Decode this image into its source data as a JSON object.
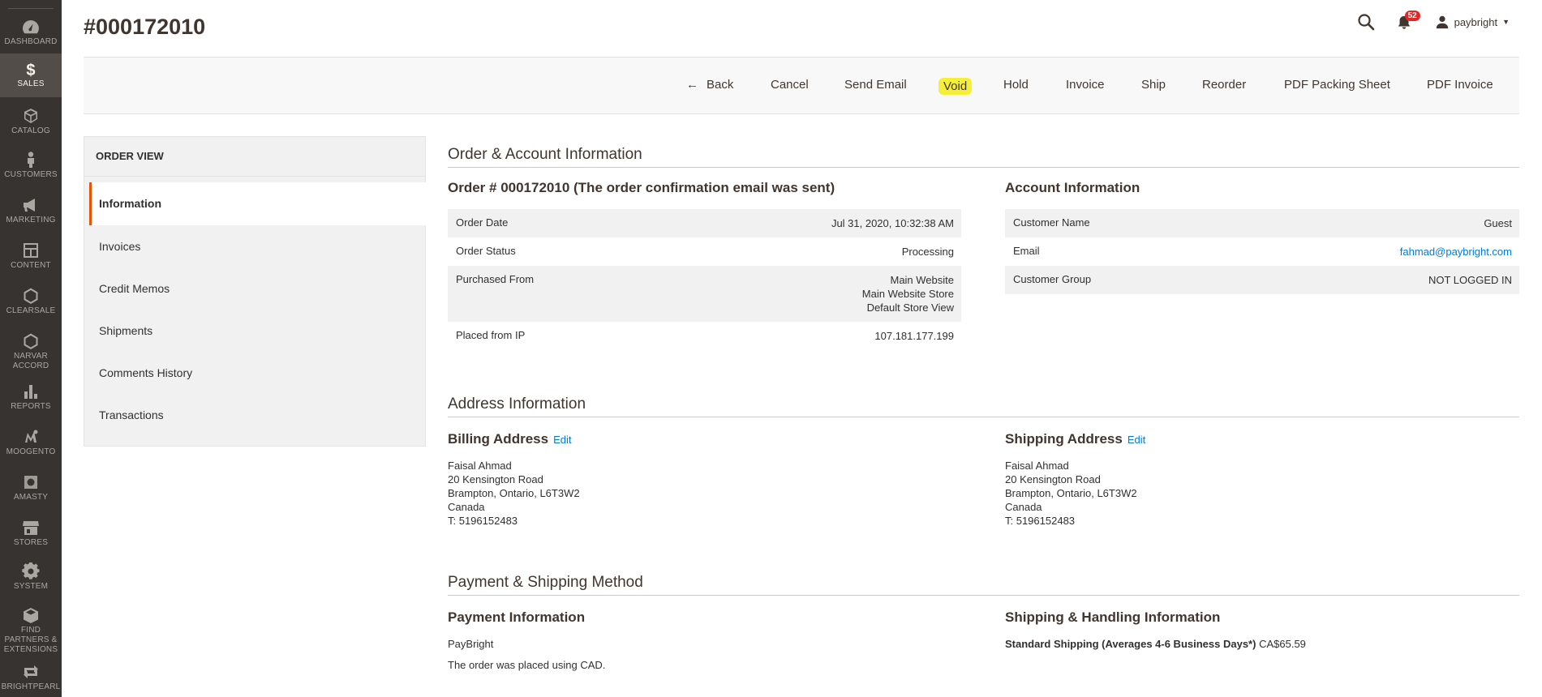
{
  "nav": {
    "items": [
      {
        "label": "DASHBOARD",
        "icon": "dashboard-icon"
      },
      {
        "label": "SALES",
        "icon": "dollar-icon",
        "active": true
      },
      {
        "label": "CATALOG",
        "icon": "cube-icon"
      },
      {
        "label": "CUSTOMERS",
        "icon": "person-icon"
      },
      {
        "label": "MARKETING",
        "icon": "megaphone-icon"
      },
      {
        "label": "CONTENT",
        "icon": "layout-icon"
      },
      {
        "label": "CLEARSALE",
        "icon": "hexagon-icon"
      },
      {
        "label": "NARVAR ACCORD",
        "icon": "hexagon-icon"
      },
      {
        "label": "REPORTS",
        "icon": "bar-chart-icon"
      },
      {
        "label": "MOOGENTO",
        "icon": "moogento-icon"
      },
      {
        "label": "AMASTY",
        "icon": "amasty-icon"
      },
      {
        "label": "STORES",
        "icon": "store-icon"
      },
      {
        "label": "SYSTEM",
        "icon": "gear-icon"
      },
      {
        "label": "FIND PARTNERS & EXTENSIONS",
        "icon": "box-icon"
      },
      {
        "label": "BRIGHTPEARL",
        "icon": "sync-icon"
      }
    ]
  },
  "header": {
    "title": "#000172010",
    "notification_count": "52",
    "username": "paybright"
  },
  "toolbar": {
    "back": "Back",
    "cancel": "Cancel",
    "send_email": "Send Email",
    "void": "Void",
    "hold": "Hold",
    "invoice": "Invoice",
    "ship": "Ship",
    "reorder": "Reorder",
    "pdf_packing": "PDF Packing Sheet",
    "pdf_invoice": "PDF Invoice"
  },
  "sidebar": {
    "title": "ORDER VIEW",
    "active": "Information",
    "items": [
      "Invoices",
      "Credit Memos",
      "Shipments",
      "Comments History",
      "Transactions"
    ]
  },
  "order_account": {
    "section_title": "Order & Account Information",
    "order_title": "Order # 000172010 (The order confirmation email was sent)",
    "order_rows": [
      {
        "label": "Order Date",
        "value": "Jul 31, 2020, 10:32:38 AM"
      },
      {
        "label": "Order Status",
        "value": "Processing"
      },
      {
        "label": "Purchased From",
        "value_lines": [
          "Main Website",
          "Main Website Store",
          "Default Store View"
        ]
      },
      {
        "label": "Placed from IP",
        "value": "107.181.177.199"
      }
    ],
    "account_title": "Account Information",
    "account_rows": [
      {
        "label": "Customer Name",
        "value": "Guest"
      },
      {
        "label": "Email",
        "value": "fahmad@paybright.com"
      },
      {
        "label": "Customer Group",
        "value": "NOT LOGGED IN"
      }
    ]
  },
  "address": {
    "section_title": "Address Information",
    "billing_title": "Billing Address",
    "shipping_title": "Shipping Address",
    "edit_label": "Edit",
    "billing_lines": [
      "Faisal Ahmad",
      "20 Kensington Road",
      "Brampton, Ontario, L6T3W2",
      "Canada",
      "T: 5196152483"
    ],
    "shipping_lines": [
      "Faisal Ahmad",
      "20 Kensington Road",
      "Brampton, Ontario, L6T3W2",
      "Canada",
      "T: 5196152483"
    ]
  },
  "payment": {
    "section_title": "Payment & Shipping Method",
    "payment_title": "Payment Information",
    "method": "PayBright",
    "currency_note": "The order was placed using CAD.",
    "shipping_title": "Shipping & Handling Information",
    "shipping_method": "Standard Shipping (Averages 4-6 Business Days*)",
    "shipping_price": "CA$65.59"
  },
  "colors": {
    "nav_bg": "#373330",
    "accent": "#eb5202",
    "link": "#007bdb",
    "highlight": "#f6ef3a",
    "badge": "#e22626"
  }
}
